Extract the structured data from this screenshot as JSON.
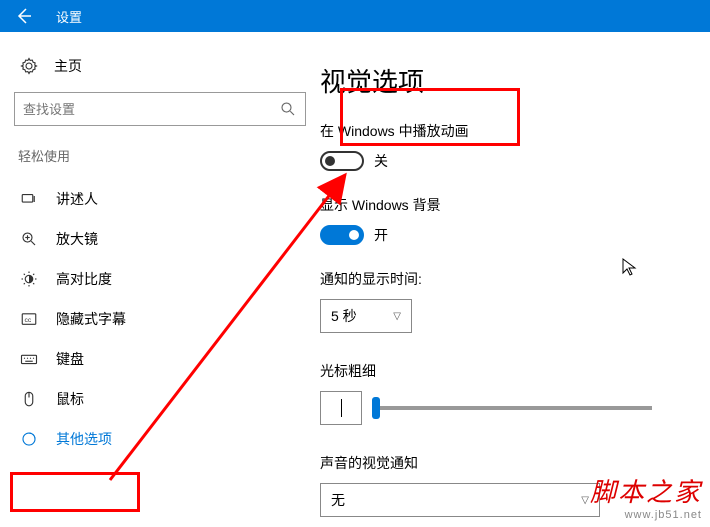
{
  "titlebar": {
    "title": "设置"
  },
  "sidebar": {
    "home": "主页",
    "search_placeholder": "查找设置",
    "section": "轻松使用",
    "items": [
      {
        "label": "讲述人"
      },
      {
        "label": "放大镜"
      },
      {
        "label": "高对比度"
      },
      {
        "label": "隐藏式字幕"
      },
      {
        "label": "键盘"
      },
      {
        "label": "鼠标"
      },
      {
        "label": "其他选项"
      }
    ]
  },
  "content": {
    "heading": "视觉选项",
    "anim_label": "在 Windows 中播放动画",
    "anim_state": "关",
    "bg_label": "显示 Windows 背景",
    "bg_state": "开",
    "notif_label": "通知的显示时间:",
    "notif_value": "5 秒",
    "cursor_label": "光标粗细",
    "sound_label": "声音的视觉通知",
    "sound_value": "无"
  },
  "watermark": {
    "line1": "脚本之家",
    "line2": "www.jb51.net"
  }
}
